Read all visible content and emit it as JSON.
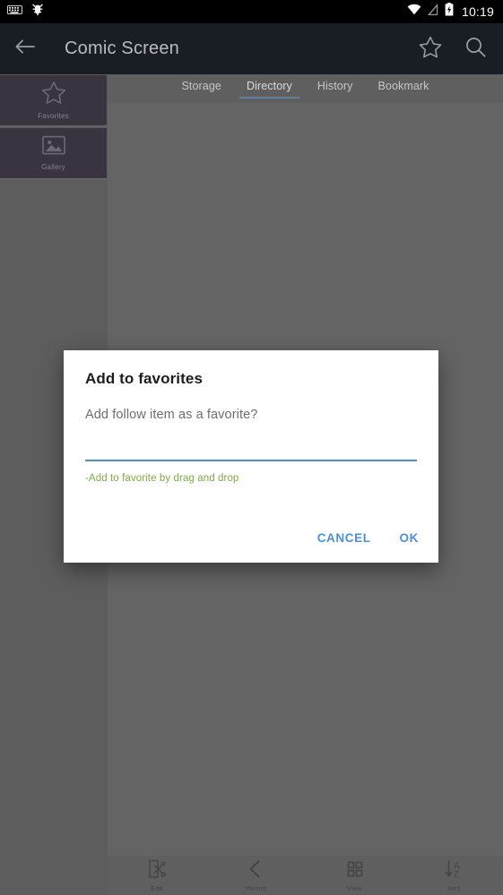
{
  "status_bar": {
    "icons_left": [
      "keyboard-icon",
      "usb-debug-icon"
    ],
    "icons_right": [
      "wifi-icon",
      "no-signal-icon",
      "battery-charging-icon"
    ],
    "time": "10:19"
  },
  "app_bar": {
    "back_icon": "back-arrow-icon",
    "title": "Comic Screen",
    "actions": [
      {
        "name": "favorite-star-icon",
        "label": "Favorite"
      },
      {
        "name": "search-icon",
        "label": "Search"
      }
    ]
  },
  "sidebar": {
    "items": [
      {
        "label": "Favorites",
        "icon": "star-outline-icon"
      },
      {
        "label": "Gallery",
        "icon": "image-icon"
      }
    ]
  },
  "tabs": [
    {
      "label": "Storage",
      "active": false
    },
    {
      "label": "Directory",
      "active": true
    },
    {
      "label": "History",
      "active": false
    },
    {
      "label": "Bookmark",
      "active": false
    }
  ],
  "bottom_bar": {
    "items": [
      {
        "label": "Edit",
        "icon": "cut-page-icon"
      },
      {
        "label": "Parent",
        "icon": "chevron-left-icon"
      },
      {
        "label": "View",
        "icon": "grid-view-icon"
      },
      {
        "label": "Sort",
        "icon": "sort-az-icon"
      }
    ]
  },
  "dialog": {
    "title": "Add to favorites",
    "message": "Add follow item as a favorite?",
    "input_value": "",
    "input_placeholder": "",
    "helper_text": "-Add to favorite by drag and drop",
    "cancel_label": "CANCEL",
    "ok_label": "OK"
  },
  "colors": {
    "status_bar_bg": "#000000",
    "app_bar_bg": "#191e24",
    "scrim_bg": "#646464",
    "sidebar_card_bg": "#39343f",
    "tab_indicator": "#5d7f9c",
    "dialog_bg": "#ffffff",
    "dialog_accent": "#4a90d9",
    "input_underline": "#4a90c4",
    "helper_green": "#7cab46"
  }
}
